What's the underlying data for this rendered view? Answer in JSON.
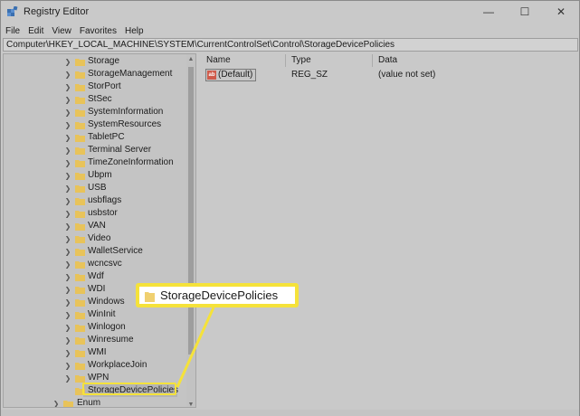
{
  "window": {
    "title": "Registry Editor",
    "controls": {
      "minimize": "—",
      "maximize": "☐",
      "close": "✕"
    }
  },
  "menu": [
    "File",
    "Edit",
    "View",
    "Favorites",
    "Help"
  ],
  "address": "Computer\\HKEY_LOCAL_MACHINE\\SYSTEM\\CurrentControlSet\\Control\\StorageDevicePolicies",
  "tree": {
    "items": [
      {
        "label": "Storage",
        "expandable": true
      },
      {
        "label": "StorageManagement",
        "expandable": true
      },
      {
        "label": "StorPort",
        "expandable": true
      },
      {
        "label": "StSec",
        "expandable": true
      },
      {
        "label": "SystemInformation",
        "expandable": true
      },
      {
        "label": "SystemResources",
        "expandable": true
      },
      {
        "label": "TabletPC",
        "expandable": true
      },
      {
        "label": "Terminal Server",
        "expandable": true
      },
      {
        "label": "TimeZoneInformation",
        "expandable": true
      },
      {
        "label": "Ubpm",
        "expandable": true
      },
      {
        "label": "USB",
        "expandable": true
      },
      {
        "label": "usbflags",
        "expandable": true
      },
      {
        "label": "usbstor",
        "expandable": true
      },
      {
        "label": "VAN",
        "expandable": true
      },
      {
        "label": "Video",
        "expandable": true
      },
      {
        "label": "WalletService",
        "expandable": true
      },
      {
        "label": "wcncsvc",
        "expandable": true
      },
      {
        "label": "Wdf",
        "expandable": true
      },
      {
        "label": "WDI",
        "expandable": true
      },
      {
        "label": "Windows",
        "expandable": true
      },
      {
        "label": "WinInit",
        "expandable": true
      },
      {
        "label": "Winlogon",
        "expandable": true
      },
      {
        "label": "Winresume",
        "expandable": true
      },
      {
        "label": "WMI",
        "expandable": true
      },
      {
        "label": "WorkplaceJoin",
        "expandable": true
      },
      {
        "label": "WPN",
        "expandable": true
      },
      {
        "label": "StorageDevicePolicies",
        "expandable": false,
        "selected": true
      }
    ],
    "next_item": "Enum"
  },
  "list": {
    "columns": [
      "Name",
      "Type",
      "Data"
    ],
    "rows": [
      {
        "name": "(Default)",
        "type": "REG_SZ",
        "data": "(value not set)"
      }
    ]
  },
  "callout": {
    "label": "StorageDevicePolicies"
  },
  "colors": {
    "callout_border": "#f5e23a",
    "folder": "#e8c35a"
  }
}
